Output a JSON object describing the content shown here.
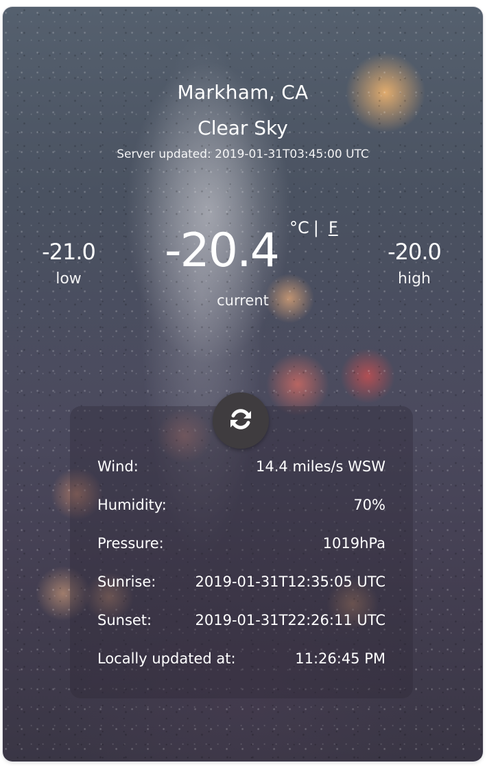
{
  "location": {
    "city": "Markham, CA",
    "condition": "Clear Sky",
    "server_updated": "Server updated: 2019-01-31T03:45:00 UTC"
  },
  "temperature": {
    "current": "-20.4",
    "current_label": "current",
    "low": "-21.0",
    "low_label": "low",
    "high": "-20.0",
    "high_label": "high",
    "unit_c": "°C",
    "unit_separator": "|",
    "unit_f": "F"
  },
  "details": [
    {
      "label": "Wind:",
      "value": "14.4 miles/s WSW"
    },
    {
      "label": "Humidity:",
      "value": "70%"
    },
    {
      "label": "Pressure:",
      "value": "1019hPa"
    },
    {
      "label": "Sunrise:",
      "value": "2019-01-31T12:35:05 UTC"
    },
    {
      "label": "Sunset:",
      "value": "2019-01-31T22:26:11 UTC"
    },
    {
      "label": "Locally updated at:",
      "value": "11:26:45 PM"
    }
  ],
  "icons": {
    "refresh": "refresh-icon"
  },
  "colors": {
    "refresh_button_bg": "#3f3c3f",
    "text": "#ffffff"
  }
}
